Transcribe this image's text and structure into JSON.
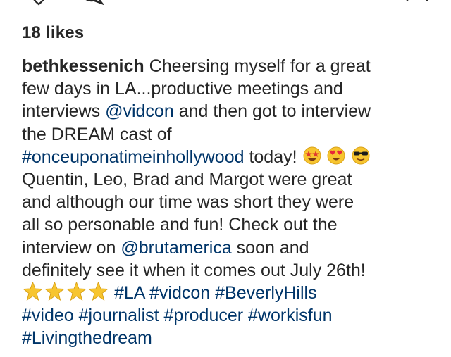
{
  "post": {
    "likes_label": "18 likes",
    "username": "bethkessenich",
    "caption": {
      "l1_text": " Cheersing myself for a great",
      "l2_text": "few days in LA...productive meetings and",
      "l3_pre": "interviews ",
      "l3_mention": "@vidcon",
      "l3_post": " and then got to interview",
      "l4_text": "the DREAM cast of",
      "l5_tag": "#onceuponatimeinhollywood",
      "l5_post": " today!",
      "l6_text": "Quentin, Leo, Brad and Margot were great",
      "l7_text": "and although our time was short they were",
      "l8_text": "all so personable and fun! Check out the",
      "l9_pre": "interview on ",
      "l9_mention": "@brutamerica",
      "l9_post": " soon and",
      "l10_text": "definitely see it when it comes out July 26th!",
      "l11_tags": " #LA #vidcon #BeverlyHills",
      "l12_tags": "#video #journalist #producer #workisfun",
      "l13_tags": "#Livingthedream"
    },
    "emojis": [
      "star-struck",
      "heart-eyes",
      "sunglasses",
      "star",
      "star",
      "star",
      "star"
    ]
  },
  "colors": {
    "text": "#262626",
    "link": "#003569",
    "background": "#ffffff"
  }
}
